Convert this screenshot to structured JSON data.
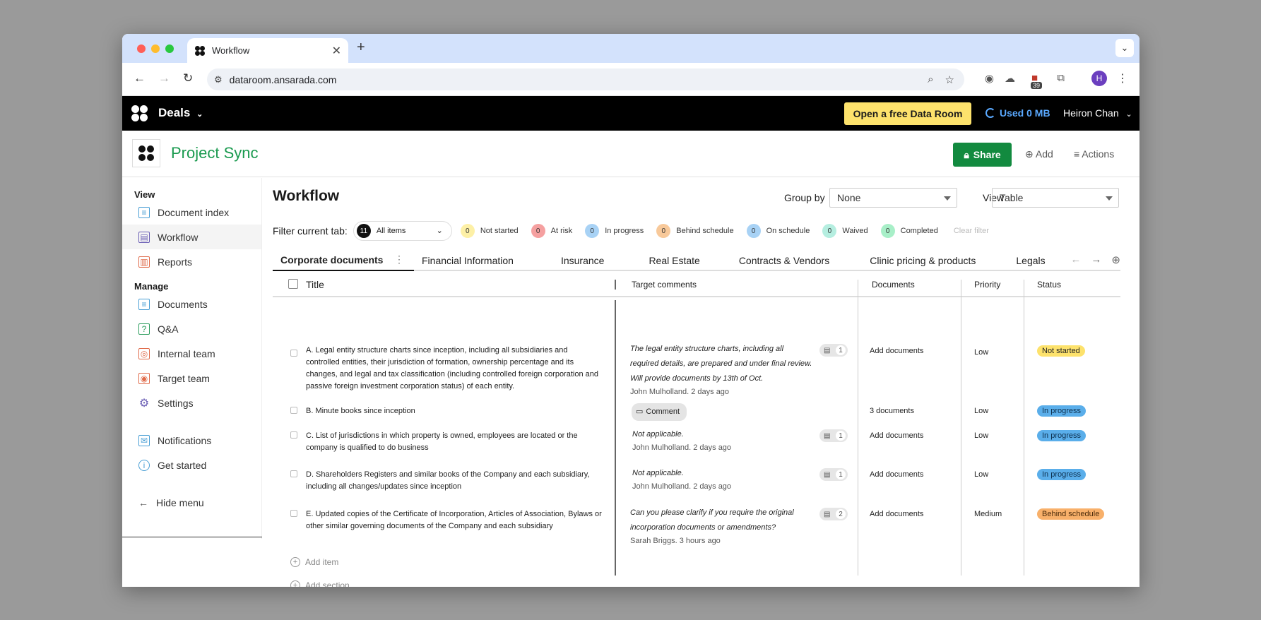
{
  "browser": {
    "tab_title": "Workflow",
    "url": "dataroom.ansarada.com",
    "ext_badge": "39",
    "profile_initial": "H"
  },
  "app": {
    "deals_label": "Deals",
    "free_room_button": "Open a free Data Room",
    "used_label": "Used 0 MB",
    "user_name": "Heiron Chan"
  },
  "project": {
    "title": "Project Sync",
    "share_label": "Share",
    "add_label": "Add",
    "actions_label": "Actions"
  },
  "sidebar": {
    "view_heading": "View",
    "view_items": [
      {
        "label": "Document index",
        "icon": "document-index-icon",
        "color": "#4a9fd5"
      },
      {
        "label": "Workflow",
        "icon": "workflow-icon",
        "color": "#6b5fb5"
      },
      {
        "label": "Reports",
        "icon": "reports-icon",
        "color": "#e06b4a"
      }
    ],
    "manage_heading": "Manage",
    "manage_items": [
      {
        "label": "Documents",
        "icon": "documents-icon",
        "color": "#4a9fd5"
      },
      {
        "label": "Q&A",
        "icon": "qa-icon",
        "color": "#2e9e5e"
      },
      {
        "label": "Internal team",
        "icon": "internal-team-icon",
        "color": "#e06b4a"
      },
      {
        "label": "Target team",
        "icon": "target-team-icon",
        "color": "#e06b4a"
      },
      {
        "label": "Settings",
        "icon": "settings-icon",
        "color": "#6b5fb5"
      }
    ],
    "notifications": "Notifications",
    "get_started": "Get started",
    "hide_menu": "Hide menu"
  },
  "workflow": {
    "title": "Workflow",
    "group_by_label": "Group by",
    "group_by_value": "None",
    "view_label": "View",
    "view_value": "Table",
    "filter_label": "Filter current tab:",
    "all_items_count": "11",
    "all_items_label": "All items",
    "filters": [
      {
        "count": "0",
        "label": "Not started",
        "color": "#fdf0a6"
      },
      {
        "count": "0",
        "label": "At risk",
        "color": "#f5a0a0"
      },
      {
        "count": "0",
        "label": "In progress",
        "color": "#a8d2f5"
      },
      {
        "count": "0",
        "label": "Behind schedule",
        "color": "#f8c99a"
      },
      {
        "count": "0",
        "label": "On schedule",
        "color": "#a8d2f5"
      },
      {
        "count": "0",
        "label": "Waived",
        "color": "#b5eee0"
      },
      {
        "count": "0",
        "label": "Completed",
        "color": "#a8efc8"
      }
    ],
    "clear_filter": "Clear filter",
    "tabs": [
      "Corporate documents",
      "Financial Information",
      "Insurance",
      "Real Estate",
      "Contracts & Vendors",
      "Clinic pricing & products",
      "Legals"
    ],
    "columns": {
      "title": "Title",
      "comments": "Target comments",
      "documents": "Documents",
      "priority": "Priority",
      "status": "Status"
    },
    "rows": [
      {
        "title": "A. Legal entity structure charts since inception, including all subsidiaries and controlled entities, their jurisdiction of formation, ownership percentage and its changes, and legal and tax classification (including controlled foreign corporation and passive foreign investment corporation status) of each entity.",
        "comment": "The legal entity structure charts, including all required details, are prepared and under final review. Will provide documents by 13th of Oct.",
        "author": "John Mulholland. 2 days ago",
        "count": "1",
        "documents": "Add documents",
        "priority": "Low",
        "status": "Not started",
        "status_color": "#fde26c"
      },
      {
        "title": "B. Minute books since inception",
        "comment_button": "Comment",
        "documents": "3 documents",
        "priority": "Low",
        "status": "In progress",
        "status_color": "#5aaeea"
      },
      {
        "title": "C. List of jurisdictions in which property is owned, employees are located or the company is qualified to do business",
        "comment": "Not applicable.",
        "author": "John Mulholland. 2 days ago",
        "count": "1",
        "documents": "Add documents",
        "priority": "Low",
        "status": "In progress",
        "status_color": "#5aaeea"
      },
      {
        "title": "D. Shareholders Registers and similar books of the Company and each subsidiary, including all changes/updates since inception",
        "comment": "Not applicable.",
        "author": "John Mulholland. 2 days ago",
        "count": "1",
        "documents": "Add documents",
        "priority": "Low",
        "status": "In progress",
        "status_color": "#5aaeea"
      },
      {
        "title": "E. Updated copies of the Certificate of Incorporation, Articles of Association, Bylaws or other similar governing documents of the Company and each subsidiary",
        "comment": "Can you please clarify if you require the original incorporation documents or amendments?",
        "author": "Sarah Briggs. 3 hours ago",
        "count": "2",
        "documents": "Add documents",
        "priority": "Medium",
        "status": "Behind schedule",
        "status_color": "#f8b06a"
      }
    ],
    "add_item": "Add item",
    "add_section": "Add section"
  }
}
